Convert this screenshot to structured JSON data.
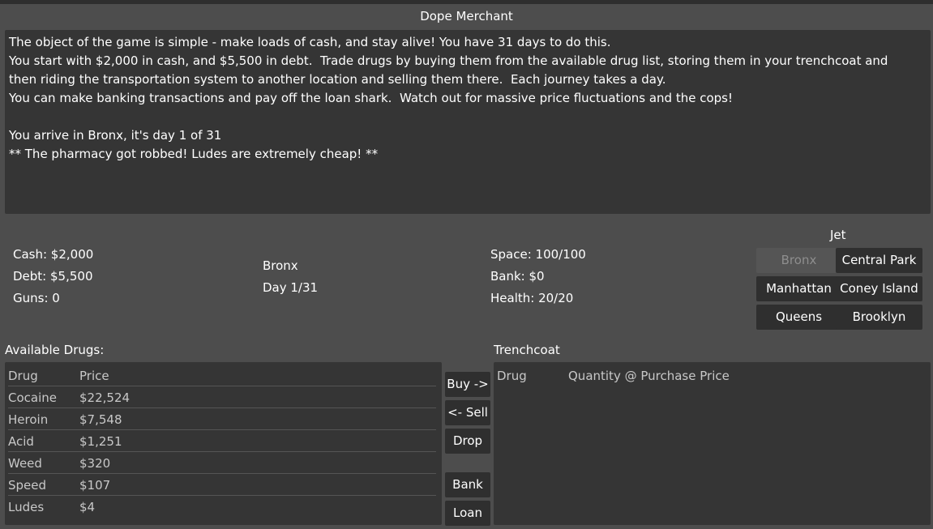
{
  "window": {
    "title": "Dope Merchant"
  },
  "log": {
    "lines": [
      "The object of the game is simple - make loads of cash, and stay alive! You have 31 days to do this.",
      "You start with $2,000 in cash, and $5,500 in debt.  Trade drugs by buying them from the available drug list, storing them in your trenchcoat and",
      "then riding the transportation system to another location and selling them there.  Each journey takes a day.",
      "You can make banking transactions and pay off the loan shark.  Watch out for massive price fluctuations and the cops!",
      "",
      "You arrive in Bronx, it's day 1 of 31",
      "** The pharmacy got robbed! Ludes are extremely cheap! **"
    ]
  },
  "stats": {
    "cash": "Cash: $2,000",
    "debt": "Debt: $5,500",
    "guns": "Guns: 0",
    "location": "Bronx",
    "day": "Day 1/31",
    "space": "Space: 100/100",
    "bank": "Bank: $0",
    "health": "Health: 20/20"
  },
  "jet": {
    "label": "Jet",
    "destinations": [
      "Bronx",
      "Central Park",
      "Manhattan",
      "Coney Island",
      "Queens",
      "Brooklyn"
    ]
  },
  "available": {
    "label": "Available Drugs:",
    "columns": [
      "Drug",
      "Price"
    ],
    "rows": [
      [
        "Cocaine",
        "$22,524"
      ],
      [
        "Heroin",
        "$7,548"
      ],
      [
        "Acid",
        "$1,251"
      ],
      [
        "Weed",
        "$320"
      ],
      [
        "Speed",
        "$107"
      ],
      [
        "Ludes",
        "$4"
      ]
    ]
  },
  "actions": {
    "buy": "Buy ->",
    "sell": "<- Sell",
    "drop": "Drop",
    "bank": "Bank",
    "loan": "Loan"
  },
  "trenchcoat": {
    "label": "Trenchcoat",
    "columns": [
      "Drug",
      "Quantity @ Purchase Price"
    ]
  },
  "colors": {
    "background": "#4d4d4d",
    "panel": "#353535",
    "button": "#2f2f2f",
    "disabled_button": "#555555"
  }
}
